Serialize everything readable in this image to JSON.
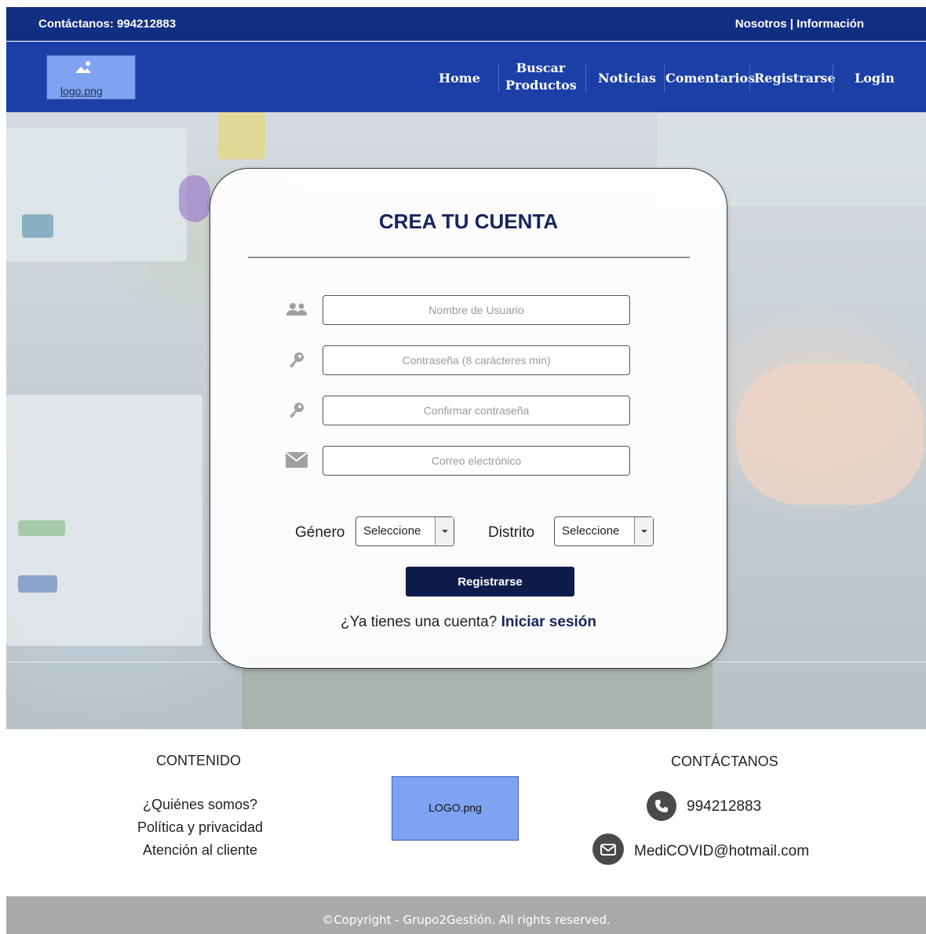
{
  "topbar": {
    "contact": "Contáctanos: 994212883",
    "about": "Nosotros | Información"
  },
  "header": {
    "logo_label": "logo.png",
    "nav": [
      "Home",
      "Buscar Productos",
      "Noticias",
      "Comentarios",
      "Registrarse",
      "Login"
    ]
  },
  "form": {
    "title": "CREA TU CUENTA",
    "fields": [
      {
        "icon": "users-icon",
        "placeholder": "Nombre de Usuario"
      },
      {
        "icon": "key-icon",
        "placeholder": "Contraseña (8 carácteres min)"
      },
      {
        "icon": "key-icon",
        "placeholder": "Confirmar contraseña"
      },
      {
        "icon": "envelope-icon",
        "placeholder": "Correo electrónico"
      }
    ],
    "gender_label": "Género",
    "gender_value": "Seleccione",
    "district_label": "Distrito",
    "district_value": "Seleccione",
    "submit_label": "Registrarse",
    "have_account": "¿Ya tienes una cuenta?",
    "login_link": "Iniciar sesión"
  },
  "footer": {
    "content_title": "CONTENIDO",
    "links": [
      "¿Quiénes somos?",
      "Política y privacidad",
      "Atención al cliente"
    ],
    "logo_label": "LOGO.png",
    "contact_title": "CONTÁCTANOS",
    "phone": "994212883",
    "email": "MediCOVID@hotmail.com",
    "copyright": "©Copyright - Grupo2Gestión. All rights reserved."
  },
  "colors": {
    "topbar": "#102e82",
    "navbar": "#1b3fa6",
    "button": "#0e1b4d",
    "logo_box": "#7fa3f0",
    "copyright_bar": "#a9a9a9"
  }
}
